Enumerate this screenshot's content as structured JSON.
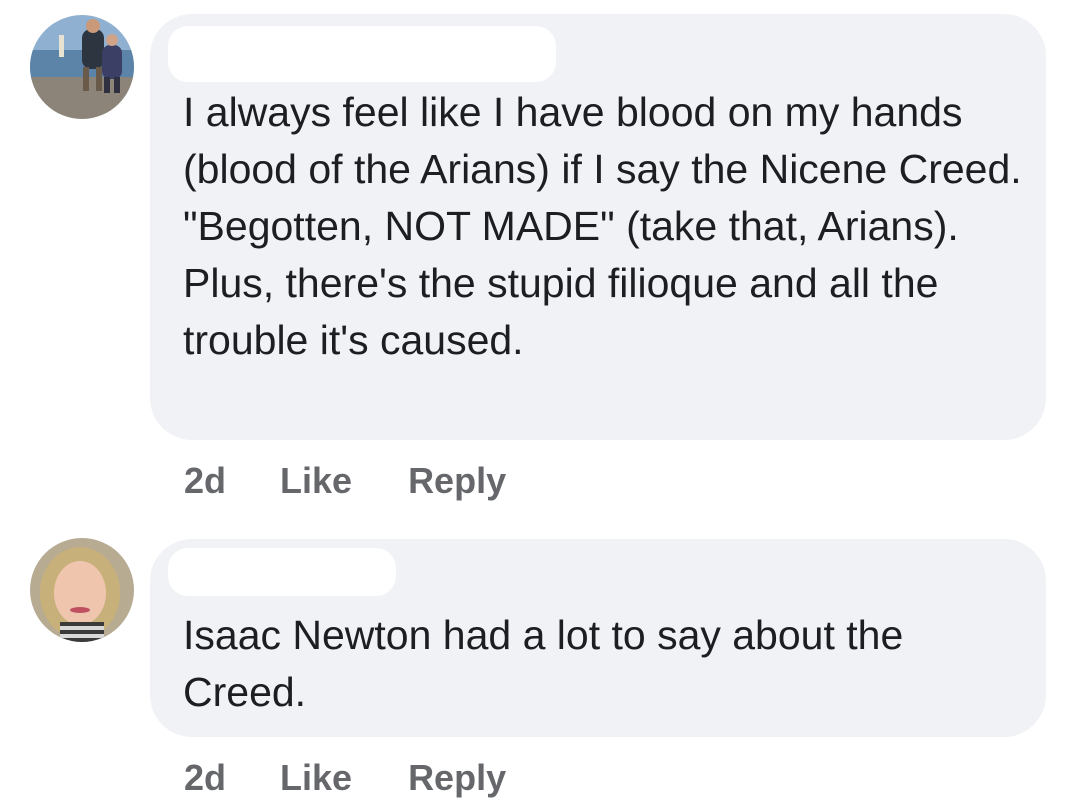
{
  "comments": [
    {
      "avatar": {
        "icon": "user-avatar-couple-lighthouse"
      },
      "text": "I always feel like I have blood on my hands (blood of the Arians) if I say the Nicene Creed. \"Begotten, NOT MADE\" (take that, Arians). Plus, there's the stupid filioque and all the trouble it's caused.",
      "time": "2d",
      "like_label": "Like",
      "reply_label": "Reply"
    },
    {
      "avatar": {
        "icon": "user-avatar-woman-portrait"
      },
      "text": "Isaac Newton had a lot to say about the Creed.",
      "time": "2d",
      "like_label": "Like",
      "reply_label": "Reply"
    }
  ],
  "colors": {
    "bubble_bg": "#f0f2f5",
    "text": "#1c1e21",
    "meta_text": "#65676b"
  }
}
